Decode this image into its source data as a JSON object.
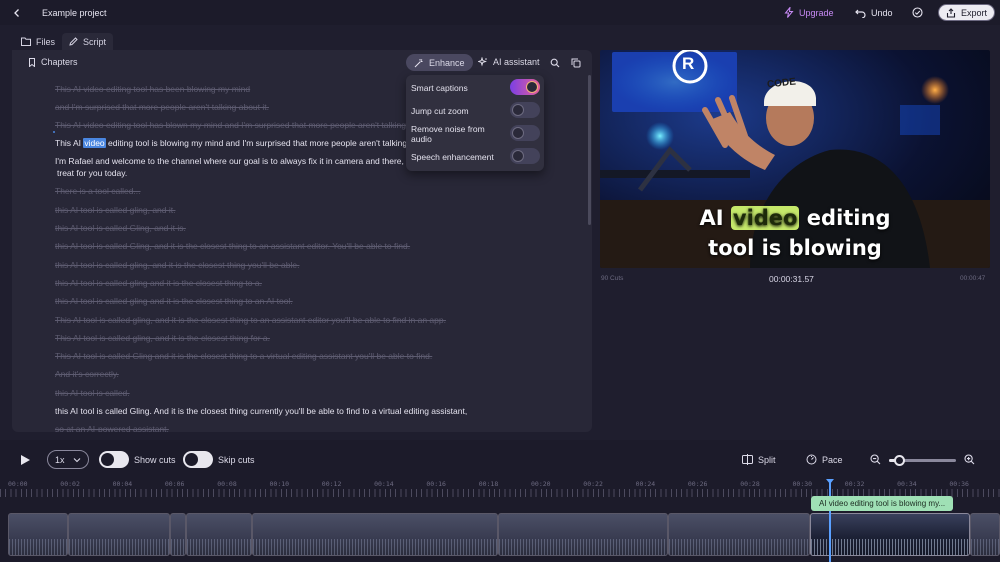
{
  "header": {
    "project_name": "Example project",
    "upgrade_label": "Upgrade",
    "undo_label": "Undo",
    "export_label": "Export"
  },
  "tabs": [
    {
      "label": "Files",
      "icon": "folder-icon"
    },
    {
      "label": "Script",
      "icon": "pen-icon"
    }
  ],
  "script_toolbar": {
    "chapters_label": "Chapters",
    "enhance_label": "Enhance",
    "ai_assistant_label": "AI assistant"
  },
  "enhance_menu": {
    "items": [
      {
        "label": "Smart captions",
        "on": true
      },
      {
        "label": "Jump cut zoom",
        "on": false
      },
      {
        "label": "Remove noise from audio",
        "on": false
      },
      {
        "label": "Speech enhancement",
        "on": false
      }
    ]
  },
  "script": {
    "lines": [
      {
        "text": "This AI video editing tool has been blowing my mind",
        "cut": true
      },
      {
        "text": "and I'm surprised that more people aren't talking about it.",
        "cut": true
      },
      {
        "text": "This AI video editing tool has blown my mind and I'm surprised that more people aren't talking about it.",
        "cut": true
      },
      {
        "text_before": "This AI ",
        "highlight": "video",
        "text_after": " editing tool is blowing my mind and I'm surprised that more people aren't talking about it.",
        "cut": false
      },
      {
        "text": "I'm Rafael and welcome to the channel where our goal is to always fix it in camera and there, but in this video I have a",
        "cut": false
      },
      {
        "text": "treat for you today.",
        "cut": false
      },
      {
        "text": "There is a tool called...",
        "cut": true
      },
      {
        "text": "this AI tool is called gling, and it.",
        "cut": true
      },
      {
        "text": "this AI tool is called Gling, and it is.",
        "cut": true
      },
      {
        "text": "this AI tool is called Gling, and it is the closest thing to an assistant editor. You'll be able to find.",
        "cut": true
      },
      {
        "text": "this AI tool is called gling, and it is the closest thing you'll be able.",
        "cut": true
      },
      {
        "text": "this AI tool is called gling and it is the closest thing to a.",
        "cut": true
      },
      {
        "text": "this AI tool is called gling and it is the closest thing to an AI tool.",
        "cut": true
      },
      {
        "text": "This AI tool is called gling, and it is the closest thing to an assistant editor you'll be able to find in an app.",
        "cut": true
      },
      {
        "text": "This AI tool is called gling, and it is the closest thing for a.",
        "cut": true
      },
      {
        "text": "This AI tool is called Gling and it is the closest thing to a virtual editing assistant you'll be able to find.",
        "cut": true
      },
      {
        "text": "And it's correctly.",
        "cut": true
      },
      {
        "text": "this AI tool is called.",
        "cut": true
      },
      {
        "text": "this AI tool is called Gling. And it is the closest thing currently you'll be able to find to a virtual editing assistant,",
        "cut": false
      },
      {
        "text": "so at an AI-powered assistant.",
        "cut": true
      }
    ]
  },
  "video": {
    "caption_line1_pre": "AI ",
    "caption_highlight": "video",
    "caption_line1_post": " editing",
    "caption_line2": "tool is blowing",
    "cap_text": "CODE",
    "logo_letter": "R",
    "cuts_label": "90 Cuts",
    "current_time": "00:00:31.57",
    "end_time": "00:00:47"
  },
  "controls": {
    "speed": "1x",
    "show_cuts_label": "Show cuts",
    "skip_cuts_label": "Skip cuts",
    "split_label": "Split",
    "pace_label": "Pace",
    "zoom_level": 0.15
  },
  "timeline": {
    "ticks": [
      "00:00",
      "00:02",
      "00:04",
      "00:06",
      "00:08",
      "00:10",
      "00:12",
      "00:14",
      "00:16",
      "00:18",
      "00:20",
      "00:22",
      "00:24",
      "00:26",
      "00:28",
      "00:30",
      "00:32",
      "00:34",
      "00:36"
    ],
    "tooltip": "AI video editing tool is blowing my..."
  },
  "colors": {
    "accent_upgrade": "#c78af5",
    "highlight": "#4a86e0",
    "tooltip": "#9fe0b5",
    "playhead": "#5aa0ff"
  }
}
